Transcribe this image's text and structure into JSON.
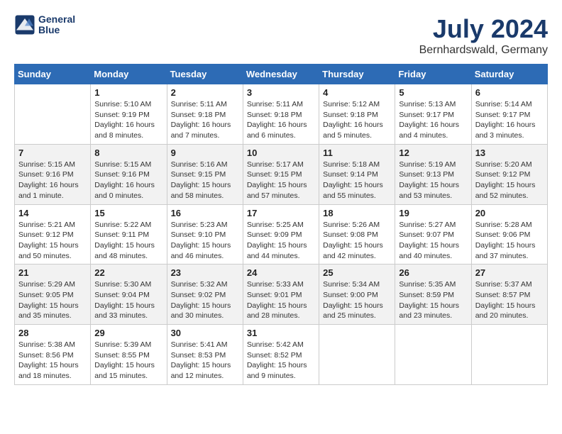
{
  "header": {
    "logo_line1": "General",
    "logo_line2": "Blue",
    "month_year": "July 2024",
    "location": "Bernhardswald, Germany"
  },
  "weekdays": [
    "Sunday",
    "Monday",
    "Tuesday",
    "Wednesday",
    "Thursday",
    "Friday",
    "Saturday"
  ],
  "weeks": [
    [
      {
        "day": "",
        "info": ""
      },
      {
        "day": "1",
        "info": "Sunrise: 5:10 AM\nSunset: 9:19 PM\nDaylight: 16 hours\nand 8 minutes."
      },
      {
        "day": "2",
        "info": "Sunrise: 5:11 AM\nSunset: 9:18 PM\nDaylight: 16 hours\nand 7 minutes."
      },
      {
        "day": "3",
        "info": "Sunrise: 5:11 AM\nSunset: 9:18 PM\nDaylight: 16 hours\nand 6 minutes."
      },
      {
        "day": "4",
        "info": "Sunrise: 5:12 AM\nSunset: 9:18 PM\nDaylight: 16 hours\nand 5 minutes."
      },
      {
        "day": "5",
        "info": "Sunrise: 5:13 AM\nSunset: 9:17 PM\nDaylight: 16 hours\nand 4 minutes."
      },
      {
        "day": "6",
        "info": "Sunrise: 5:14 AM\nSunset: 9:17 PM\nDaylight: 16 hours\nand 3 minutes."
      }
    ],
    [
      {
        "day": "7",
        "info": "Sunrise: 5:15 AM\nSunset: 9:16 PM\nDaylight: 16 hours\nand 1 minute."
      },
      {
        "day": "8",
        "info": "Sunrise: 5:15 AM\nSunset: 9:16 PM\nDaylight: 16 hours\nand 0 minutes."
      },
      {
        "day": "9",
        "info": "Sunrise: 5:16 AM\nSunset: 9:15 PM\nDaylight: 15 hours\nand 58 minutes."
      },
      {
        "day": "10",
        "info": "Sunrise: 5:17 AM\nSunset: 9:15 PM\nDaylight: 15 hours\nand 57 minutes."
      },
      {
        "day": "11",
        "info": "Sunrise: 5:18 AM\nSunset: 9:14 PM\nDaylight: 15 hours\nand 55 minutes."
      },
      {
        "day": "12",
        "info": "Sunrise: 5:19 AM\nSunset: 9:13 PM\nDaylight: 15 hours\nand 53 minutes."
      },
      {
        "day": "13",
        "info": "Sunrise: 5:20 AM\nSunset: 9:12 PM\nDaylight: 15 hours\nand 52 minutes."
      }
    ],
    [
      {
        "day": "14",
        "info": "Sunrise: 5:21 AM\nSunset: 9:12 PM\nDaylight: 15 hours\nand 50 minutes."
      },
      {
        "day": "15",
        "info": "Sunrise: 5:22 AM\nSunset: 9:11 PM\nDaylight: 15 hours\nand 48 minutes."
      },
      {
        "day": "16",
        "info": "Sunrise: 5:23 AM\nSunset: 9:10 PM\nDaylight: 15 hours\nand 46 minutes."
      },
      {
        "day": "17",
        "info": "Sunrise: 5:25 AM\nSunset: 9:09 PM\nDaylight: 15 hours\nand 44 minutes."
      },
      {
        "day": "18",
        "info": "Sunrise: 5:26 AM\nSunset: 9:08 PM\nDaylight: 15 hours\nand 42 minutes."
      },
      {
        "day": "19",
        "info": "Sunrise: 5:27 AM\nSunset: 9:07 PM\nDaylight: 15 hours\nand 40 minutes."
      },
      {
        "day": "20",
        "info": "Sunrise: 5:28 AM\nSunset: 9:06 PM\nDaylight: 15 hours\nand 37 minutes."
      }
    ],
    [
      {
        "day": "21",
        "info": "Sunrise: 5:29 AM\nSunset: 9:05 PM\nDaylight: 15 hours\nand 35 minutes."
      },
      {
        "day": "22",
        "info": "Sunrise: 5:30 AM\nSunset: 9:04 PM\nDaylight: 15 hours\nand 33 minutes."
      },
      {
        "day": "23",
        "info": "Sunrise: 5:32 AM\nSunset: 9:02 PM\nDaylight: 15 hours\nand 30 minutes."
      },
      {
        "day": "24",
        "info": "Sunrise: 5:33 AM\nSunset: 9:01 PM\nDaylight: 15 hours\nand 28 minutes."
      },
      {
        "day": "25",
        "info": "Sunrise: 5:34 AM\nSunset: 9:00 PM\nDaylight: 15 hours\nand 25 minutes."
      },
      {
        "day": "26",
        "info": "Sunrise: 5:35 AM\nSunset: 8:59 PM\nDaylight: 15 hours\nand 23 minutes."
      },
      {
        "day": "27",
        "info": "Sunrise: 5:37 AM\nSunset: 8:57 PM\nDaylight: 15 hours\nand 20 minutes."
      }
    ],
    [
      {
        "day": "28",
        "info": "Sunrise: 5:38 AM\nSunset: 8:56 PM\nDaylight: 15 hours\nand 18 minutes."
      },
      {
        "day": "29",
        "info": "Sunrise: 5:39 AM\nSunset: 8:55 PM\nDaylight: 15 hours\nand 15 minutes."
      },
      {
        "day": "30",
        "info": "Sunrise: 5:41 AM\nSunset: 8:53 PM\nDaylight: 15 hours\nand 12 minutes."
      },
      {
        "day": "31",
        "info": "Sunrise: 5:42 AM\nSunset: 8:52 PM\nDaylight: 15 hours\nand 9 minutes."
      },
      {
        "day": "",
        "info": ""
      },
      {
        "day": "",
        "info": ""
      },
      {
        "day": "",
        "info": ""
      }
    ]
  ]
}
